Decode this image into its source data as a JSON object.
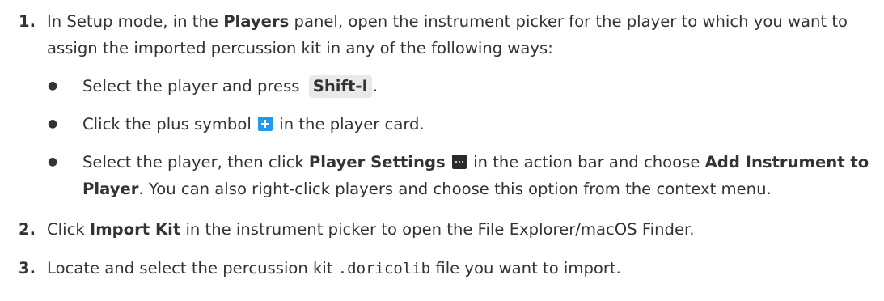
{
  "steps": [
    {
      "number": "1.",
      "text_a": "In Setup mode, in the ",
      "bold_a": "Players",
      "text_b": " panel, open the instrument picker for the player to which you want to assign the imported percussion kit in any of the following ways:",
      "options": [
        {
          "text_a": "Select the player and press ",
          "key": "Shift-I",
          "text_b": "."
        },
        {
          "text_a": "Click the plus symbol ",
          "icon": "plus-icon",
          "text_b": " in the player card."
        },
        {
          "text_a": "Select the player, then click ",
          "bold_a": "Player Settings",
          "icon": "more-icon",
          "text_b": " in the action bar and choose ",
          "bold_b": "Add Instrument to Player",
          "text_c": ". You can also right-click players and choose this option from the context menu."
        }
      ]
    },
    {
      "number": "2.",
      "text_a": "Click ",
      "bold_a": "Import Kit",
      "text_b": " in the instrument picker to open the File Explorer/macOS Finder."
    },
    {
      "number": "3.",
      "text_a": "Locate and select the percussion kit ",
      "code": ".doricolib",
      "text_b": " file you want to import."
    }
  ],
  "bullet_glyph": "●",
  "colors": {
    "text": "#333333",
    "key_background": "#e9e9e9",
    "plus_icon": "#1e9bf0",
    "more_icon": "#2a2a2a"
  }
}
